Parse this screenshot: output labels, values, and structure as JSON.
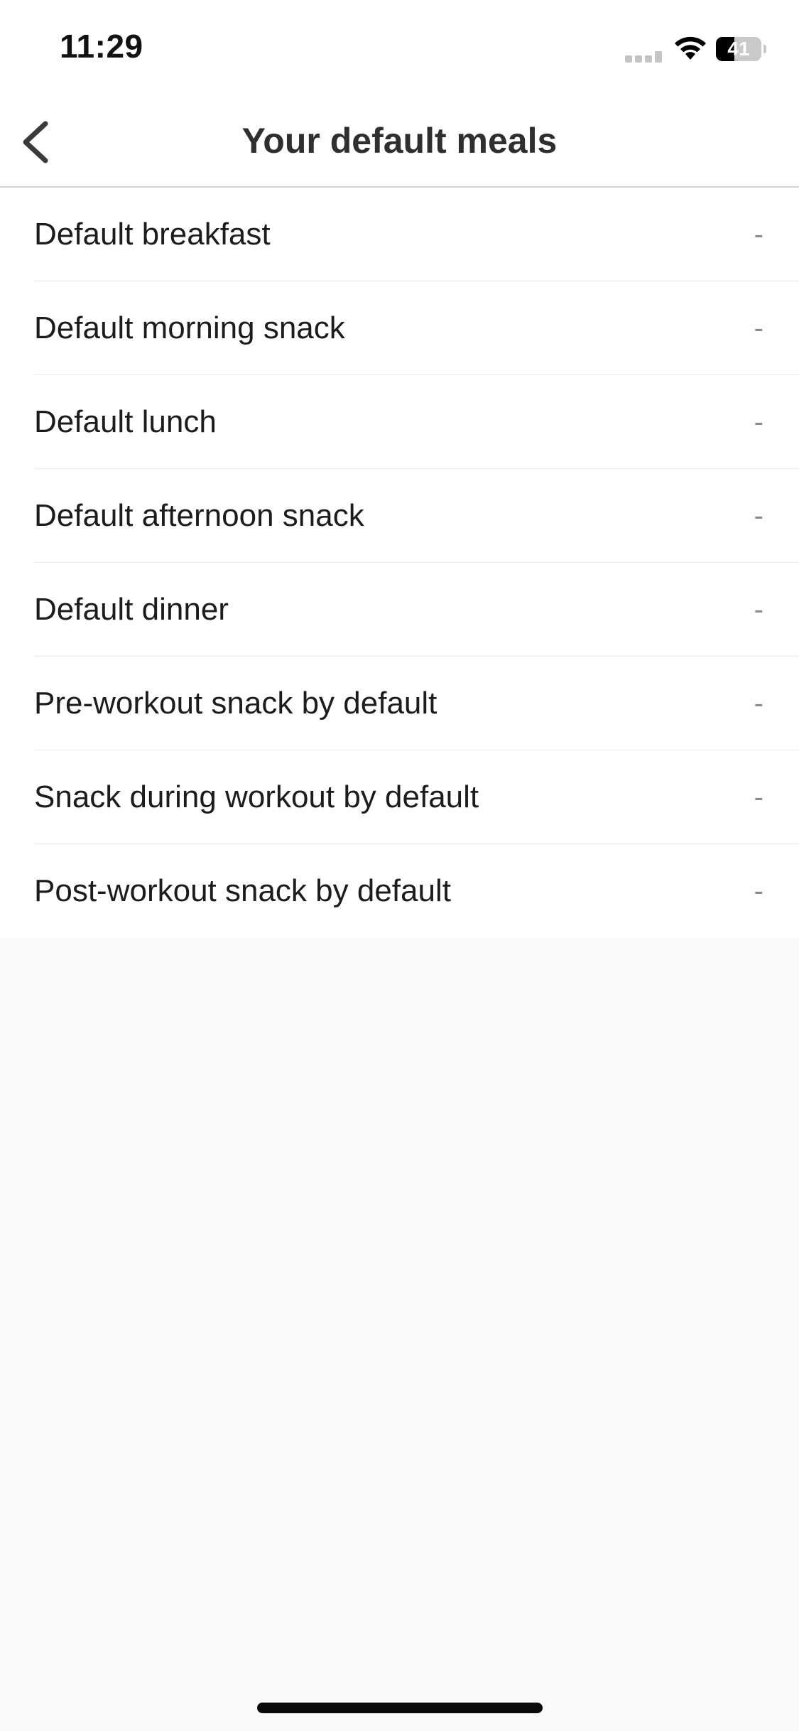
{
  "status_bar": {
    "time": "11:29",
    "battery_level": "41",
    "battery_fraction": 0.41,
    "icons": [
      "cellular-signal-icon",
      "wifi-icon",
      "battery-icon"
    ]
  },
  "header": {
    "title": "Your default meals",
    "back_icon": "chevron-left-icon"
  },
  "meals": [
    {
      "label": "Default breakfast",
      "value": "-"
    },
    {
      "label": "Default morning snack",
      "value": "-"
    },
    {
      "label": "Default lunch",
      "value": "-"
    },
    {
      "label": "Default afternoon snack",
      "value": "-"
    },
    {
      "label": "Default dinner",
      "value": "-"
    },
    {
      "label": "Pre-workout snack by default",
      "value": "-"
    },
    {
      "label": "Snack during workout by default",
      "value": "-"
    },
    {
      "label": "Post-workout snack by default",
      "value": "-"
    }
  ],
  "colors": {
    "background": "#f9f9f9",
    "surface": "#ffffff",
    "text": "#1c1c1c",
    "secondary_text": "#8a8a8a",
    "divider": "#ececec"
  }
}
